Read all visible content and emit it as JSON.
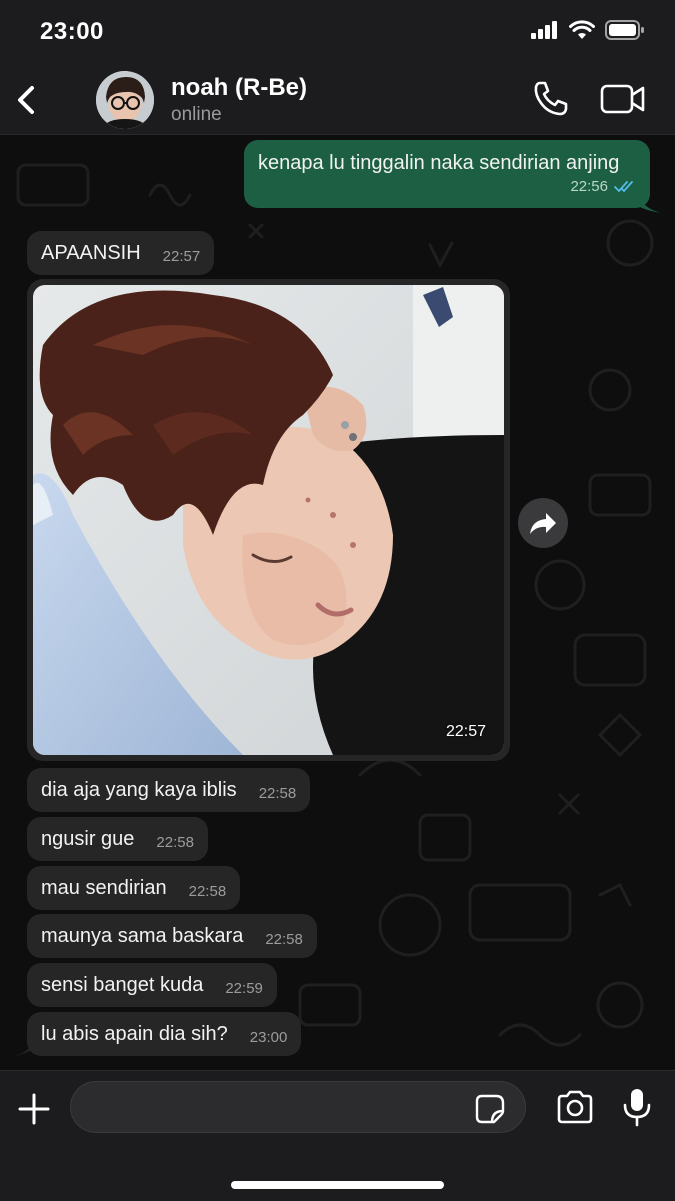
{
  "status_bar": {
    "time": "23:00",
    "icons": [
      "cellular-signal-icon",
      "wifi-icon",
      "battery-icon"
    ]
  },
  "header": {
    "back_icon": "chevron-left-icon",
    "contact_name": "noah (R-Be)",
    "contact_status": "online",
    "call_icon": "phone-icon",
    "video_icon": "video-camera-icon"
  },
  "messages": [
    {
      "direction": "out",
      "text": "kenapa lu tinggalin naka sendirian anjing",
      "time": "22:56",
      "read_icon": "double-check-icon"
    },
    {
      "direction": "in",
      "text": "APAANSIH",
      "time": "22:57"
    },
    {
      "direction": "in",
      "type": "photo",
      "time": "22:57",
      "forward_icon": "forward-icon"
    },
    {
      "direction": "in",
      "text": "dia aja yang kaya iblis",
      "time": "22:58"
    },
    {
      "direction": "in",
      "text": "ngusir gue",
      "time": "22:58"
    },
    {
      "direction": "in",
      "text": "mau sendirian",
      "time": "22:58"
    },
    {
      "direction": "in",
      "text": "maunya sama baskara",
      "time": "22:58"
    },
    {
      "direction": "in",
      "text": "sensi banget kuda",
      "time": "22:59"
    },
    {
      "direction": "in",
      "text": "lu abis apain dia sih?",
      "time": "23:00"
    }
  ],
  "input_bar": {
    "plus_icon": "plus-icon",
    "message_value": "",
    "sticker_icon": "sticker-icon",
    "camera_icon": "camera-icon",
    "mic_icon": "microphone-icon"
  },
  "colors": {
    "header_bg": "#1c1c1e",
    "chat_bg": "#0e0e0e",
    "incoming_bubble": "#262626",
    "outgoing_bubble": "#1c5f43",
    "read_tick": "#53bdeb"
  }
}
